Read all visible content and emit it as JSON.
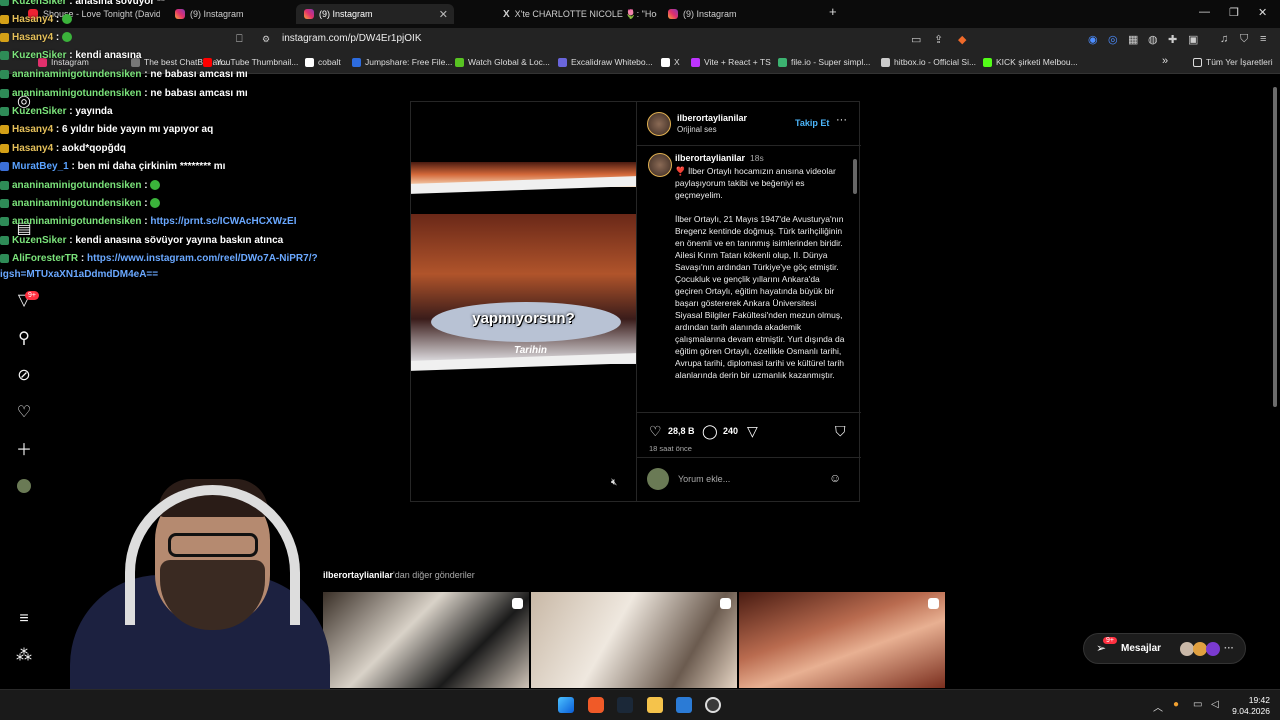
{
  "browser": {
    "tabs": [
      {
        "label": "Shouse - Love Tonight (David Guetta"
      },
      {
        "label": "(9) Instagram"
      },
      {
        "label": "(9) Instagram"
      },
      {
        "label": "X'te CHARLOTTE NICOLE 🌷: \"Hooo"
      },
      {
        "label": "(9) Instagram"
      }
    ],
    "new_tab": "+",
    "url": "instagram.com/p/DW4Er1pjOIK",
    "bookmarks": [
      {
        "label": "Instagram",
        "color": "#e1306c"
      },
      {
        "label": "The best ChatBot an...",
        "color": "#777777"
      },
      {
        "label": "YouTube Thumbnail...",
        "color": "#ff0000"
      },
      {
        "label": "cobalt",
        "color": "#ffffff"
      },
      {
        "label": "Jumpshare: Free File...",
        "color": "#2d6cdf"
      },
      {
        "label": "Watch Global & Loc...",
        "color": "#58c322"
      },
      {
        "label": "Excalidraw Whitebo...",
        "color": "#6965db"
      },
      {
        "label": "X",
        "color": "#ffffff"
      },
      {
        "label": "Vite + React + TS",
        "color": "#bd34fe"
      },
      {
        "label": "file.io - Super simpl...",
        "color": "#3cb371"
      },
      {
        "label": "hitbox.io - Official Si...",
        "color": "#cccccc"
      },
      {
        "label": "KICK şirketi Melbou...",
        "color": "#53fc18"
      }
    ],
    "bookmarks_overflow": "»",
    "all_bookmarks": "Tüm Yer İşaretleri"
  },
  "chat": [
    {
      "name": "KuzenSiker",
      "text": ": anasına sövüyor **",
      "color": "green"
    },
    {
      "name": "Hasany4",
      "text": ":",
      "color": "yellow",
      "emote": true
    },
    {
      "name": "Hasany4",
      "text": ":",
      "color": "yellow",
      "emote": true
    },
    {
      "name": "KuzenSiker",
      "text": ": kendi anasına",
      "color": "green"
    },
    {
      "name": "ananinaminigotundensiken",
      "text": ": ne babası amcası mı",
      "color": "green"
    },
    {
      "name": "ananinaminigotundensiken",
      "text": ": ne babası amcası mı",
      "color": "green"
    },
    {
      "name": "KuzenSiker",
      "text": ": yayında",
      "color": "green"
    },
    {
      "name": "Hasany4",
      "text": ": 6 yıldır bide yayın mı yapıyor aq",
      "color": "yellow"
    },
    {
      "name": "Hasany4",
      "text": ": aokd*qopğdq",
      "color": "yellow"
    },
    {
      "name": "MuratBey_1",
      "text": ": ben mi daha çirkinim ******** mı",
      "color": "blue"
    },
    {
      "name": "ananinaminigotundensiken",
      "text": ":",
      "color": "green",
      "emote": true
    },
    {
      "name": "ananinaminigotundensiken",
      "text": ":",
      "color": "green",
      "emote": true
    },
    {
      "name": "ananinaminigotundensiken",
      "text": ":",
      "color": "green",
      "link": "https://prnt.sc/ICWAcHCXWzEI"
    },
    {
      "name": "KuzenSiker",
      "text": ": kendi anasına sövüyor yayına baskın atınca",
      "color": "green"
    },
    {
      "name": "AliForesterTR",
      "text": ":",
      "color": "green",
      "link": "https://www.instagram.com/reel/DWo7A-NiPR7/?"
    },
    {
      "name": "",
      "text": "",
      "color": "blue",
      "link": "igsh=MTUxaXN1aDdmdDM4eA=="
    }
  ],
  "nav": {
    "notifications_badge": "9+"
  },
  "post": {
    "author": "ilberortaylianilar",
    "audio": "Orijinal ses",
    "follow": "Takip Et",
    "more": "···",
    "video_caption": "yapmıyorsun?",
    "video_logo": "Tarihin",
    "caption_time": "18s",
    "caption": "❣️ İlber Ortaylı hocamızın anısına videolar paylaşıyorum takibi ve beğeniyi es geçmeyelim.\n\nİlber Ortaylı, 21 Mayıs 1947'de Avusturya'nın Bregenz kentinde doğmuş. Türk tarihçiliğinin en önemli ve en tanınmış isimlerinden biridir. Ailesi Kırım Tatarı kökenli olup, II. Dünya Savaşı'nın ardından Türkiye'ye göç etmiştir. Çocukluk ve gençlik yıllarını Ankara'da geçiren Ortaylı, eğitim hayatında büyük bir başarı göstererek Ankara Üniversitesi Siyasal Bilgiler Fakültesi'nden mezun olmuş, ardından tarih alanında akademik çalışmalarına devam etmiştir. Yurt dışında da eğitim gören Ortaylı, özellikle Osmanlı tarihi, Avrupa tarihi, diplomasi tarihi ve kültürel tarih alanlarında derin bir uzmanlık kazanmıştır.",
    "likes": "28,8 B",
    "comments": "240",
    "time_ago": "18 saat önce",
    "comment_placeholder": "Yorum ekle..."
  },
  "more_posts": {
    "author": "ilberortaylianilar",
    "suffix": "'dan diğer gönderiler"
  },
  "messages": {
    "label": "Mesajlar",
    "badge": "9+"
  },
  "taskbar": {
    "time": "19:42",
    "date": "9.04.2026"
  }
}
